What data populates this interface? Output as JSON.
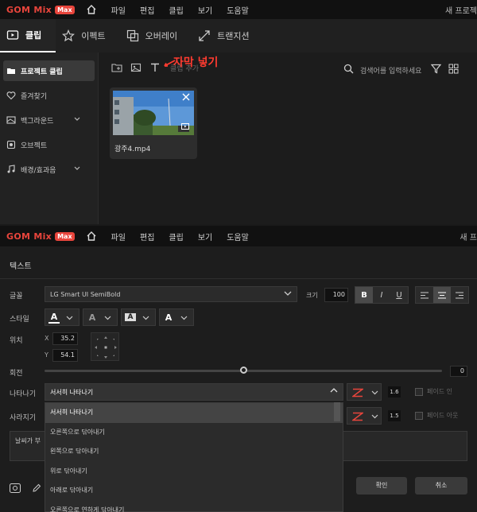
{
  "top": {
    "logo": {
      "text": "GOM Mix",
      "badge": "Max"
    },
    "menu": [
      "파일",
      "편집",
      "클립",
      "보기",
      "도움말"
    ],
    "menu_right": "새 프로젝",
    "tabs": [
      {
        "label": "클립",
        "icon": "clip-icon",
        "active": true
      },
      {
        "label": "이펙트",
        "icon": "effect-icon",
        "active": false
      },
      {
        "label": "오버레이",
        "icon": "overlay-icon",
        "active": false
      },
      {
        "label": "트랜지션",
        "icon": "transition-icon",
        "active": false
      }
    ],
    "sidebar": [
      {
        "label": "프로젝트 클립",
        "icon": "folder-icon",
        "active": true
      },
      {
        "label": "즐겨찾기",
        "icon": "heart-icon"
      },
      {
        "label": "백그라운드",
        "icon": "background-icon",
        "expandable": true
      },
      {
        "label": "오브젝트",
        "icon": "object-icon"
      },
      {
        "label": "배경/효과음",
        "icon": "music-icon",
        "expandable": true
      }
    ],
    "toolbar_hint": "클립 추가",
    "annotation": "자막 넣기",
    "search_placeholder": "검색어를 입력하세요",
    "clip": {
      "name": "광주4.mp4"
    }
  },
  "bottom": {
    "logo": {
      "text": "GOM Mix",
      "badge": "Max"
    },
    "menu": [
      "파일",
      "편집",
      "클립",
      "보기",
      "도움말"
    ],
    "menu_right": "새 프",
    "panel_title": "텍스트",
    "font": {
      "label": "글꼴",
      "value": "LG Smart UI SemiBold"
    },
    "size": {
      "label": "크기",
      "value": "100"
    },
    "format_buttons": [
      "B",
      "I",
      "U"
    ],
    "style_label": "스타일",
    "style_glyphs": [
      "A",
      "A",
      "A",
      "A"
    ],
    "position": {
      "label": "위치",
      "x_label": "X",
      "x": "35.2",
      "y_label": "Y",
      "y": "54.1"
    },
    "rotation": {
      "label": "회전",
      "value": "0"
    },
    "appear": {
      "label": "나타나기",
      "value": "서서히 나타나기",
      "duration": "1.6",
      "check_label": "페이드 인"
    },
    "disappear": {
      "label": "사라지기",
      "duration": "1.5",
      "check_label": "페이드 아웃"
    },
    "text_content": "날씨가 부",
    "dropdown_options": [
      "서서히 나타나기",
      "오른쪽으로 닦아내기",
      "왼쪽으로 닦아내기",
      "위로 닦아내기",
      "아래로 닦아내기",
      "오른쪽으로 연하게 닦아내기"
    ],
    "ok_label": "확인",
    "cancel_label": "취소"
  }
}
